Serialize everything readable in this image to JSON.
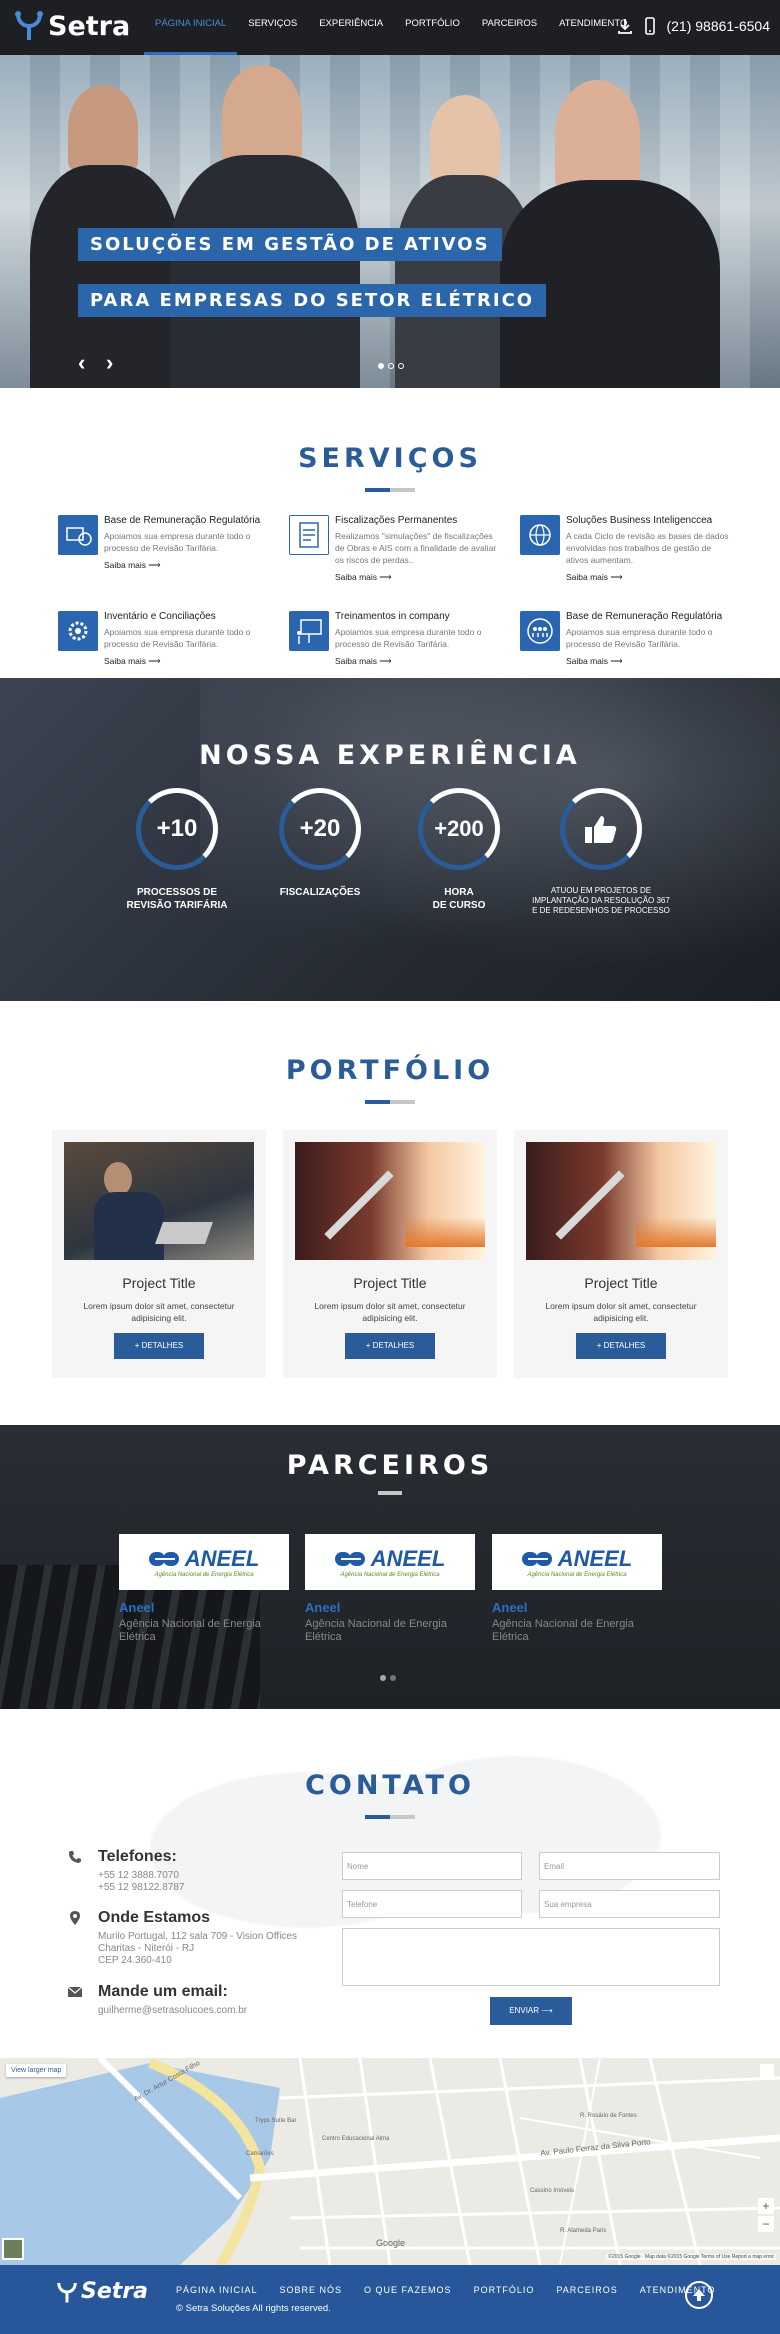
{
  "header": {
    "brand": "Setra",
    "nav": [
      "PÁGINA INICIAL",
      "SERVIÇOS",
      "EXPERIÊNCIA",
      "PORTFÓLIO",
      "PARCEIROS",
      "ATENDIMENTO"
    ],
    "active_nav": "PÁGINA INICIAL",
    "phone": "(21) 98861-6504",
    "icons": [
      "download-icon",
      "phone-icon"
    ]
  },
  "hero": {
    "line1": "SOLUÇÕES EM GESTÃO DE ATIVOS",
    "line2": "PARA EMPRESAS DO SETOR ELÉTRICO",
    "prev": "‹",
    "next": "›",
    "slide_count": 3,
    "active_slide": 1
  },
  "services": {
    "title": "SERVIÇOS",
    "items": [
      {
        "title": "Base de Remuneração Regulatória",
        "desc": "Apoiamos sua empresa durante todo o processo de Revisão Tarifária.",
        "more": "Saiba mais ⟶",
        "icon": "money-icon"
      },
      {
        "title": "Fiscalizações Permanentes",
        "desc": "Realizamos \"simulações\" de fiscalizações de Obras e AIS com a finalidade de avaliar os riscos de perdas..",
        "more": "Saiba mais ⟶",
        "icon": "checklist-icon"
      },
      {
        "title": "Soluções Business Inteligenccea",
        "desc": "A cada Ciclo de revisão as bases de dados envolvidas nos trabalhos de gestão de ativos aumentam.",
        "more": "Saiba mais ⟶",
        "icon": "globe-icon"
      },
      {
        "title": "Inventário e Conciliações",
        "desc": "Apoiamos sua empresa durante todo o processo de Revisão Tarifária.",
        "more": "Saiba mais ⟶",
        "icon": "gear-icon"
      },
      {
        "title": "Treinamentos in company",
        "desc": "Apoiamos sua empresa durante todo o processo de Revisão Tarifária.",
        "more": "Saiba mais ⟶",
        "icon": "presentation-icon"
      },
      {
        "title": "Base de Remuneração Regulatória",
        "desc": "Apoiamos sua empresa durante todo o processo de Revisão Tarifária.",
        "more": "Saiba mais ⟶",
        "icon": "team-icon"
      }
    ]
  },
  "experience": {
    "title": "NOSSA EXPERIÊNCIA",
    "stats": [
      {
        "value": "+10",
        "label1": "PROCESSOS DE",
        "label2": "REVISÃO TARIFÁRIA"
      },
      {
        "value": "+20",
        "label1": "FISCALIZAÇÕES",
        "label2": ""
      },
      {
        "value": "+200",
        "label1": "HORA",
        "label2": "DE CURSO"
      },
      {
        "value": "",
        "label1": "ATUOU EM PROJETOS DE IMPLANTAÇÃO DA RESOLUÇÃO 367 E DE REDESENHOS DE PROCESSO",
        "label2": "",
        "icon": "thumbs-up-icon"
      }
    ]
  },
  "portfolio": {
    "title": "PORTFÓLIO",
    "cards": [
      {
        "title": "Project Title",
        "desc": "Lorem ipsum dolor sit amet, consectetur adipisicing elit.",
        "button": "+ DETALHES"
      },
      {
        "title": "Project Title",
        "desc": "Lorem ipsum dolor sit amet, consectetur adipisicing elit.",
        "button": "+ DETALHES"
      },
      {
        "title": "Project Title",
        "desc": "Lorem ipsum dolor sit amet, consectetur adipisicing elit.",
        "button": "+ DETALHES"
      }
    ]
  },
  "partners": {
    "title": "PARCEIROS",
    "items": [
      {
        "logo": "ANEEL",
        "logo_sub": "Agência Nacional de Energia Elétrica",
        "name": "Aneel",
        "desc": "Agência Nacional de Energia Elétrica"
      },
      {
        "logo": "ANEEL",
        "logo_sub": "Agência Nacional de Energia Elétrica",
        "name": "Aneel",
        "desc": "Agência Nacional de Energia Elétrica"
      },
      {
        "logo": "ANEEL",
        "logo_sub": "Agência Nacional de Energia Elétrica",
        "name": "Aneel",
        "desc": "Agência Nacional de Energia Elétrica"
      }
    ]
  },
  "contact": {
    "title": "CONTATO",
    "phones_h": "Telefones:",
    "phone1": "+55 12 3888.7070",
    "phone2": "+55 12 98122.8787",
    "address_h": "Onde Estamos",
    "addr1": "Murilo Portugal, 112 sala 709 - Vision Offices",
    "addr2": "Charitas - Niterói - RJ",
    "addr3": "CEP 24.360-410",
    "email_h": "Mande um email:",
    "email": "guilherme@setrasolucoes.com.br",
    "form": {
      "name": "Nome",
      "email": "Email",
      "phone": "Telefone",
      "company": "Sua empresa",
      "send": "ENVIAR ⟶"
    }
  },
  "map": {
    "larger": "View larger map",
    "labels": [
      "Av. Dr. Artur Costa Filho",
      "Av. Paulo Ferraz da Silva Porto",
      "Camarões",
      "Tryps Suíte Bar",
      "Centro Educacional Alma",
      "R. Rosário de Fontes",
      "Cassino Imóveis",
      "R. Alameda Paris"
    ],
    "google": "Google",
    "attrib": "©2015 Google · Map data ©2015 Google  Terms of Use  Report a map error"
  },
  "footer": {
    "brand": "Setra",
    "nav": [
      "PÁGINA INICIAL",
      "SOBRE NÓS",
      "O QUE FAZEMOS",
      "PORTFÓLIO",
      "PARCEIROS",
      "ATENDIMENTO"
    ],
    "copyright": "© Setra Soluções All rights reserved."
  },
  "colors": {
    "primary": "#2a5c9a",
    "dark": "#1d1f23",
    "footer": "#27579a"
  }
}
